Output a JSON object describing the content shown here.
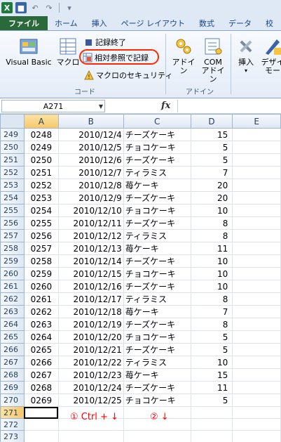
{
  "qat": {
    "undo_label": "↶",
    "redo_label": "↷",
    "more_label": "▾"
  },
  "tabs": [
    {
      "label": "ファイル",
      "kind": "file"
    },
    {
      "label": "ホーム",
      "kind": "normal"
    },
    {
      "label": "挿入",
      "kind": "normal"
    },
    {
      "label": "ページ レイアウト",
      "kind": "normal"
    },
    {
      "label": "数式",
      "kind": "normal"
    },
    {
      "label": "データ",
      "kind": "normal"
    },
    {
      "label": "校",
      "kind": "normal"
    }
  ],
  "ribbon": {
    "code": {
      "visual_basic": "Visual Basic",
      "macro": "マクロ",
      "stop_recording": "記録終了",
      "relative_ref": "相対参照で記録",
      "macro_security": "マクロのセキュリティ",
      "group_label": "コード"
    },
    "addins": {
      "addin": "アドイン",
      "com_addin_1": "COM",
      "com_addin_2": "アドイン",
      "group_label": "アドイン"
    },
    "controls": {
      "insert": "挿入",
      "design_1": "デザイ",
      "design_2": "モー"
    }
  },
  "formula_bar": {
    "name_box": "A271",
    "fx": "fx",
    "formula": ""
  },
  "columns": [
    "A",
    "B",
    "C",
    "D",
    "E"
  ],
  "rows": [
    {
      "n": "249",
      "a": "0248",
      "b": "2010/12/4",
      "c": "チーズケーキ",
      "d": "15"
    },
    {
      "n": "250",
      "a": "0249",
      "b": "2010/12/5",
      "c": "チョコケーキ",
      "d": "5"
    },
    {
      "n": "251",
      "a": "0250",
      "b": "2010/12/6",
      "c": "チーズケーキ",
      "d": "5"
    },
    {
      "n": "252",
      "a": "0251",
      "b": "2010/12/7",
      "c": "ティラミス",
      "d": "7"
    },
    {
      "n": "253",
      "a": "0252",
      "b": "2010/12/8",
      "c": "苺ケーキ",
      "d": "20"
    },
    {
      "n": "254",
      "a": "0253",
      "b": "2010/12/9",
      "c": "チーズケーキ",
      "d": "20"
    },
    {
      "n": "255",
      "a": "0254",
      "b": "2010/12/10",
      "c": "チョコケーキ",
      "d": "10"
    },
    {
      "n": "256",
      "a": "0255",
      "b": "2010/12/11",
      "c": "チーズケーキ",
      "d": "8"
    },
    {
      "n": "257",
      "a": "0256",
      "b": "2010/12/12",
      "c": "ティラミス",
      "d": "8"
    },
    {
      "n": "258",
      "a": "0257",
      "b": "2010/12/13",
      "c": "苺ケーキ",
      "d": "11"
    },
    {
      "n": "259",
      "a": "0258",
      "b": "2010/12/14",
      "c": "チーズケーキ",
      "d": "10"
    },
    {
      "n": "260",
      "a": "0259",
      "b": "2010/12/15",
      "c": "チョコケーキ",
      "d": "10"
    },
    {
      "n": "261",
      "a": "0260",
      "b": "2010/12/16",
      "c": "チーズケーキ",
      "d": "10"
    },
    {
      "n": "262",
      "a": "0261",
      "b": "2010/12/17",
      "c": "ティラミス",
      "d": "8"
    },
    {
      "n": "263",
      "a": "0262",
      "b": "2010/12/18",
      "c": "苺ケーキ",
      "d": "7"
    },
    {
      "n": "264",
      "a": "0263",
      "b": "2010/12/19",
      "c": "チーズケーキ",
      "d": "8"
    },
    {
      "n": "265",
      "a": "0264",
      "b": "2010/12/20",
      "c": "チョコケーキ",
      "d": "5"
    },
    {
      "n": "266",
      "a": "0265",
      "b": "2010/12/21",
      "c": "チーズケーキ",
      "d": "5"
    },
    {
      "n": "267",
      "a": "0266",
      "b": "2010/12/22",
      "c": "ティラミス",
      "d": "10"
    },
    {
      "n": "268",
      "a": "0267",
      "b": "2010/12/23",
      "c": "苺ケーキ",
      "d": "15"
    },
    {
      "n": "269",
      "a": "0268",
      "b": "2010/12/24",
      "c": "チーズケーキ",
      "d": "11"
    },
    {
      "n": "270",
      "a": "0269",
      "b": "2010/12/25",
      "c": "チョコケーキ",
      "d": "5"
    },
    {
      "n": "271",
      "a": "",
      "b": "",
      "c": "",
      "d": ""
    },
    {
      "n": "272",
      "a": "",
      "b": "",
      "c": "",
      "d": ""
    },
    {
      "n": "273",
      "a": "",
      "b": "",
      "c": "",
      "d": ""
    }
  ],
  "active_row": "271",
  "notes": {
    "note1": "① Ctrl + ↓",
    "note2": "② ↓"
  }
}
